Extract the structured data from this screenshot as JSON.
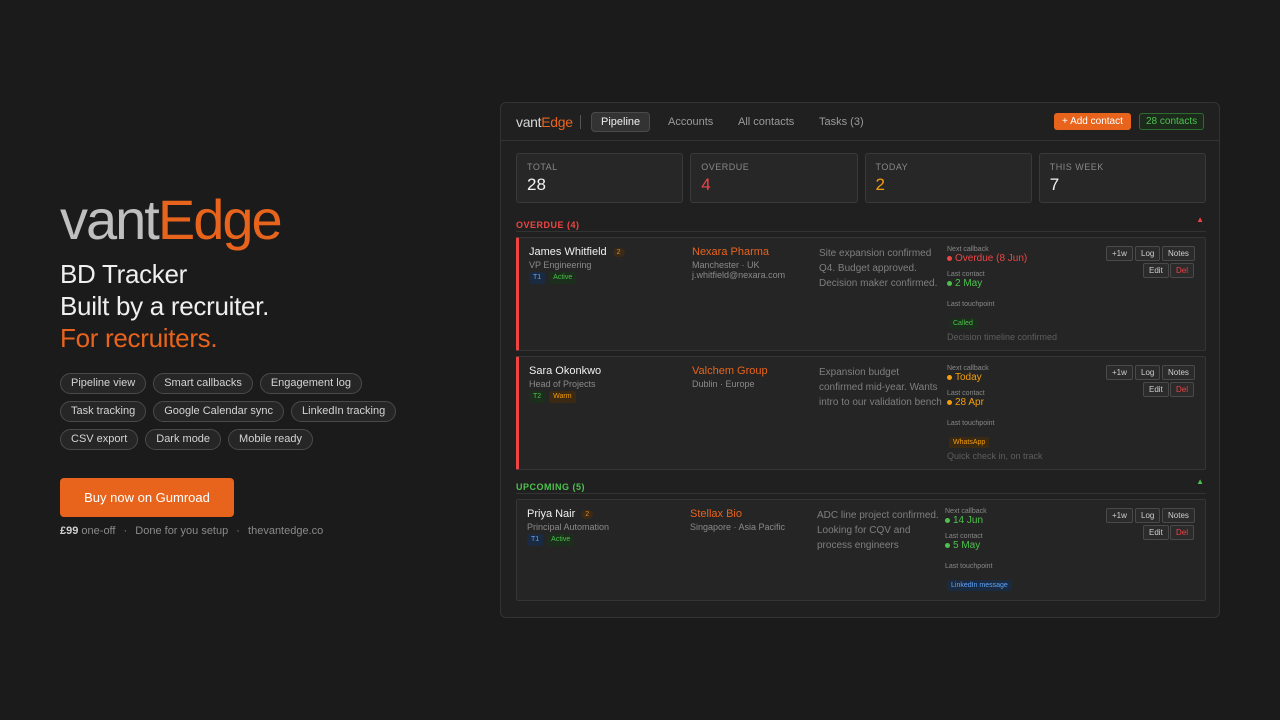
{
  "hero": {
    "brand_a": "vant",
    "brand_b": "Edge",
    "line1": "BD Tracker",
    "line2": "Built by a recruiter.",
    "line3": "For recruiters.",
    "features": [
      "Pipeline view",
      "Smart callbacks",
      "Engagement log",
      "Task tracking",
      "Google Calendar sync",
      "LinkedIn tracking",
      "CSV export",
      "Dark mode",
      "Mobile ready"
    ],
    "buy_label": "Buy now on Gumroad",
    "price": "£99",
    "price_suffix": "one-off",
    "setup": "Done for you setup",
    "site": "thevantedge.co",
    "sep": "·"
  },
  "app": {
    "logo_a": "vant",
    "logo_b": "Edge",
    "tabs": [
      "Pipeline",
      "Accounts",
      "All contacts",
      "Tasks (3)"
    ],
    "active_tab": "Pipeline",
    "add_contact": "+ Add contact",
    "contacts_count": "28 contacts",
    "stats": [
      {
        "label": "TOTAL",
        "value": "28"
      },
      {
        "label": "OVERDUE",
        "value": "4"
      },
      {
        "label": "TODAY",
        "value": "2"
      },
      {
        "label": "THIS WEEK",
        "value": "7"
      }
    ],
    "sections": {
      "overdue": "OVERDUE (4)",
      "upcoming": "UPCOMING (5)",
      "arrow": "▲"
    },
    "labels": {
      "next_callback": "Next callback",
      "last_contact": "Last contact",
      "last_touchpoint": "Last touchpoint",
      "plus1w": "+1w",
      "log": "Log",
      "notes": "Notes",
      "edit": "Edit",
      "del": "Del"
    },
    "contacts": [
      {
        "name": "James Whitfield",
        "count": "2",
        "role": "VP Engineering",
        "tier": "T1",
        "status": "Active",
        "company": "Nexara Pharma",
        "location": "Manchester · UK",
        "email": "j.whitfield@nexara.com",
        "description": "Site expansion confirmed Q4. Budget approved. Decision maker confirmed.",
        "next_callback": "Overdue (8 Jun)",
        "last_contact": "2 May",
        "touchpoint": "Called",
        "touchpoint_note": "Decision timeline confirmed"
      },
      {
        "name": "Sara Okonkwo",
        "role": "Head of Projects",
        "tier": "T2",
        "status": "Warm",
        "company": "Valchem Group",
        "location": "Dublin · Europe",
        "description": "Expansion budget confirmed mid-year. Wants intro to our validation bench",
        "next_callback": "Today",
        "last_contact": "28 Apr",
        "touchpoint": "WhatsApp",
        "touchpoint_note": "Quick check in, on track"
      },
      {
        "name": "Priya Nair",
        "count": "2",
        "role": "Principal Automation",
        "tier": "T1",
        "status": "Active",
        "company": "Stellax Bio",
        "location": "Singapore · Asia Pacific",
        "description": "ADC line project confirmed. Looking for CQV and process engineers",
        "next_callback": "14 Jun",
        "last_contact": "5 May",
        "touchpoint": "LinkedIn message"
      }
    ]
  }
}
